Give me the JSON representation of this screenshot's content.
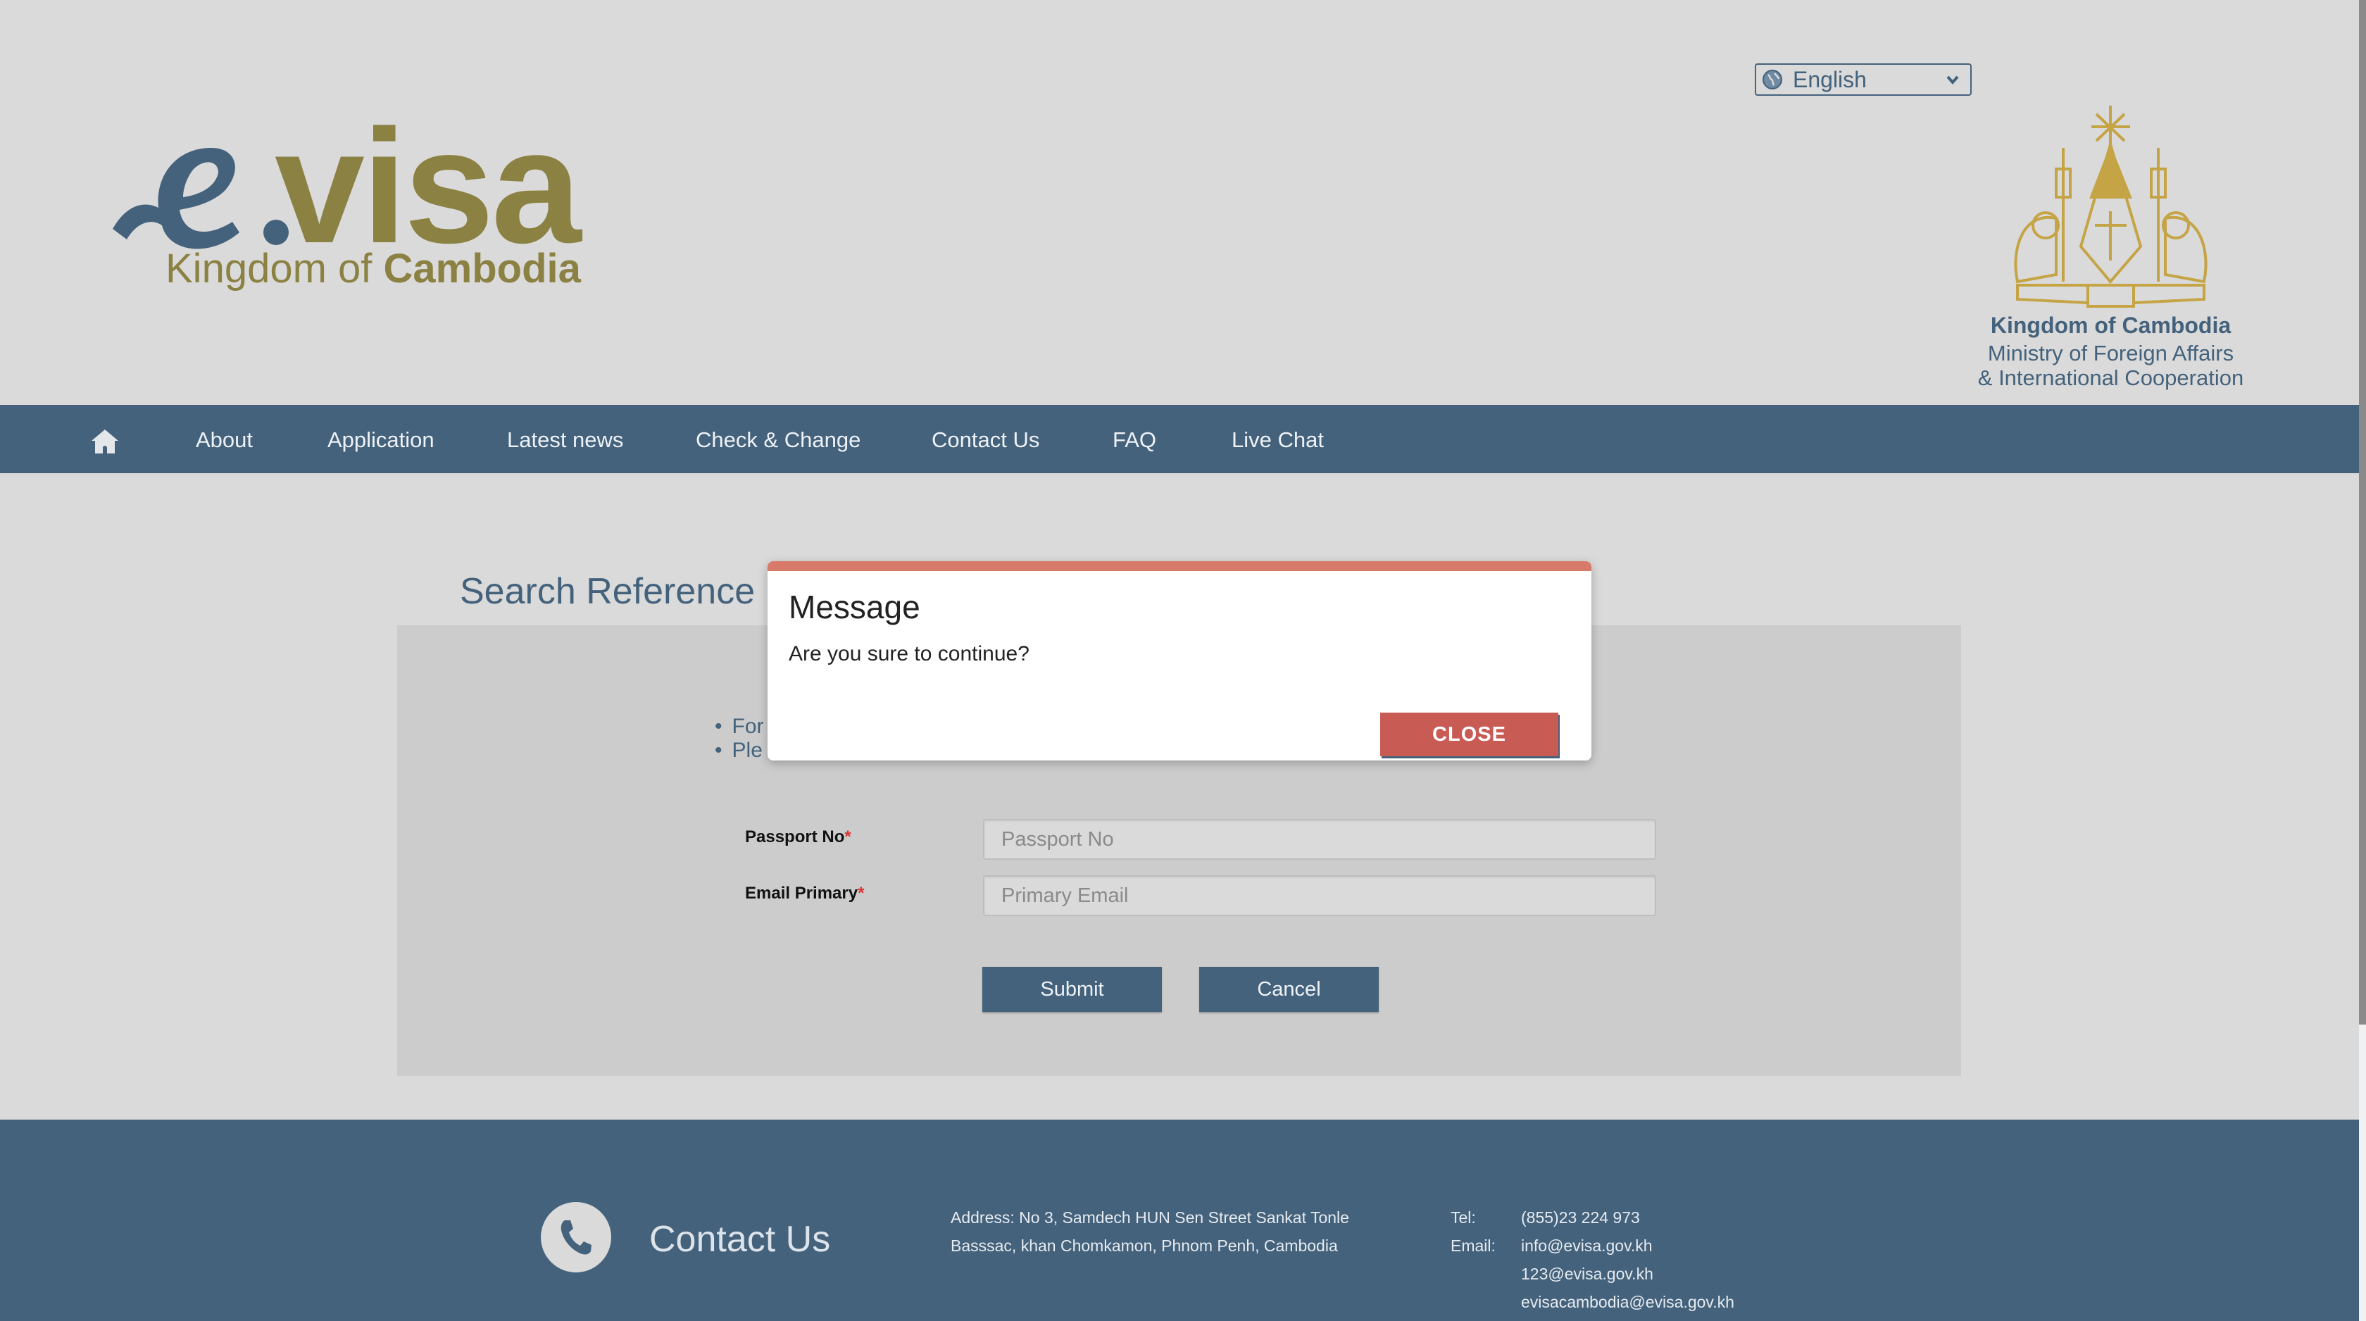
{
  "header": {
    "language_select": {
      "selected": "English",
      "icon": "globe-icon"
    },
    "logo": {
      "mark": "e",
      "word": "visa",
      "sub_prefix": "Kingdom of ",
      "sub_bold": "Cambodia"
    },
    "ministry": {
      "line1": "Kingdom of Cambodia",
      "line2": "Ministry of Foreign Affairs",
      "line3": "& International Cooperation"
    }
  },
  "nav": {
    "home_icon": "home-icon",
    "items": [
      {
        "label": "About"
      },
      {
        "label": "Application"
      },
      {
        "label": "Latest news"
      },
      {
        "label": "Check & Change"
      },
      {
        "label": "Contact Us"
      },
      {
        "label": "FAQ"
      },
      {
        "label": "Live Chat"
      }
    ]
  },
  "main": {
    "title": "Search Reference N",
    "bullets": [
      "For",
      "Ple"
    ],
    "form": {
      "passport": {
        "label": "Passport No",
        "required_mark": "*",
        "placeholder": "Passport No",
        "value": ""
      },
      "email": {
        "label": "Email Primary",
        "required_mark": "*",
        "placeholder": "Primary Email",
        "value": ""
      },
      "submit_label": "Submit",
      "cancel_label": "Cancel"
    }
  },
  "modal": {
    "title": "Message",
    "message": "Are you sure to continue?",
    "close_label": "CLOSE",
    "accent_color": "#d77a6a",
    "button_color": "#c95b55"
  },
  "footer": {
    "title": "Contact Us",
    "phone_icon": "phone-icon",
    "address_line1": "Address: No 3, Samdech HUN Sen Street Sankat Tonle",
    "address_line2": "Basssac, khan Chomkamon, Phnom Penh, Cambodia",
    "tel_label": "Tel:",
    "tel_value": "(855)23 224 973",
    "email_label": "Email:",
    "emails": [
      "info@evisa.gov.kh",
      "123@evisa.gov.kh",
      "evisacambodia@evisa.gov.kh"
    ]
  },
  "colors": {
    "brand_blue": "#44627c",
    "brand_gold": "#8b8143",
    "background": "#dadada",
    "panel": "#cccccc"
  }
}
